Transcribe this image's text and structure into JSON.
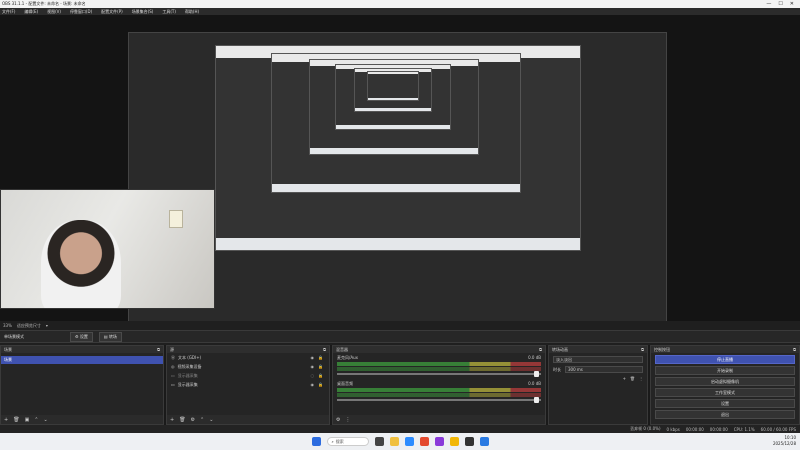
{
  "titlebar": {
    "text": "OBS 31.1.1 - 配置文件: 未命名 - 场景: 未命名",
    "min": "—",
    "max": "☐",
    "close": "✕"
  },
  "menu": {
    "items": [
      "文件(F)",
      "编辑(E)",
      "视图(V)",
      "停靠窗口(D)",
      "配置文件(P)",
      "场景集合(S)",
      "工具(T)",
      "帮助(H)"
    ]
  },
  "preview_bar": {
    "zoom": "33%",
    "label": "适应预览尺寸"
  },
  "scene_bar": {
    "title": "单场景模式",
    "settings": "设置",
    "transition_btn": "转场"
  },
  "scenes": {
    "title": "场景",
    "items": [
      "场景"
    ]
  },
  "sources": {
    "title": "源",
    "items": [
      "文本 (GDI+)",
      "视频采集设备",
      "显示器采集",
      "显示器采集"
    ]
  },
  "mixer": {
    "title": "混音器",
    "tracks": [
      {
        "name": "麦克风/Aux",
        "db": "0.0 dB"
      },
      {
        "name": "桌面音频",
        "db": "0.0 dB"
      }
    ]
  },
  "transitions": {
    "title": "转场动画",
    "type": "淡入淡出",
    "duration_label": "时长",
    "duration": "300 ms"
  },
  "controls": {
    "title": "控制按钮",
    "buttons": [
      "停止直播",
      "开始录制",
      "启动虚拟摄像机",
      "工作室模式",
      "设置",
      "退出"
    ]
  },
  "status": {
    "dropped": "丢弃帧 0 (0.0%)",
    "bitrate": "0 kbps",
    "live": "00:00:00",
    "rec": "00:00:00",
    "cpu": "CPU: 1.1%",
    "fps": "60.00 / 60.00 FPS"
  },
  "taskbar": {
    "search": "搜索",
    "time": "10:10",
    "date": "2025/12/28"
  }
}
